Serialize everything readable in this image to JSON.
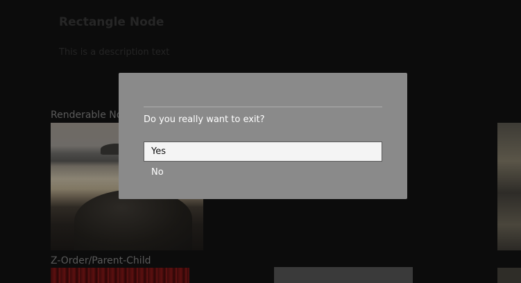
{
  "background": {
    "title": "Rectangle Node",
    "description": "This is a description text",
    "sections": [
      {
        "label": "Renderable Node"
      },
      {
        "label": "Z-Order/Parent-Child"
      }
    ]
  },
  "dialog": {
    "message": "Do you really want to exit?",
    "options": [
      {
        "label": "Yes",
        "focused": true
      },
      {
        "label": "No",
        "focused": false
      }
    ]
  },
  "colors": {
    "page_background": "#0c0c0c",
    "dialog_background": "#8a8a8a",
    "focused_option_background": "#f4f4f4"
  }
}
